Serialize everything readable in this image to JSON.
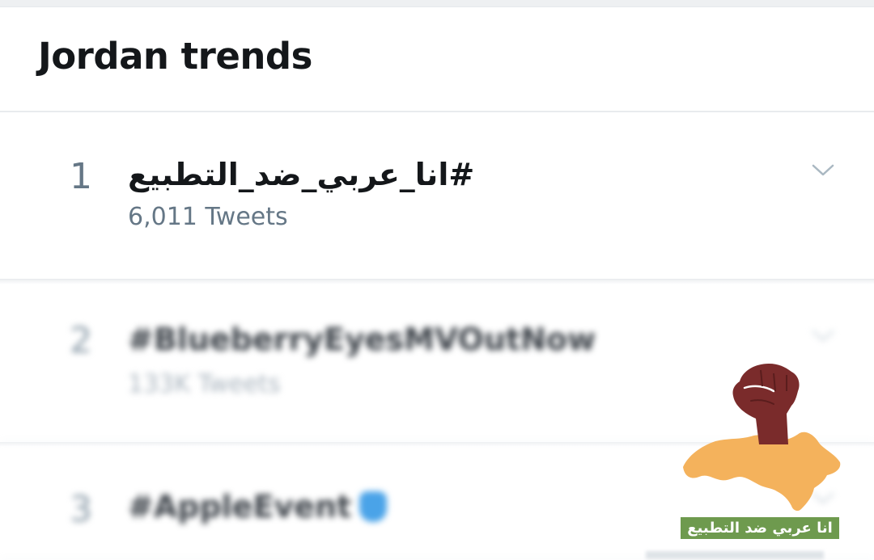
{
  "header": {
    "title": "Jordan trends"
  },
  "trends": [
    {
      "rank": "1",
      "name": "#انا_عربي_ضد_التطبيع",
      "meta": "6,011 Tweets"
    },
    {
      "rank": "2",
      "name": "#BlueberryEyesMVOutNow",
      "meta": "133K Tweets"
    },
    {
      "rank": "3",
      "name": "#AppleEvent"
    }
  ],
  "watermark": {
    "caption": "انا عربي ضد التطبيع",
    "fist_color": "#7a2b2b",
    "map_color": "#f4b25c",
    "caption_bg": "#6e9a4e"
  },
  "colors": {
    "text_primary": "#14171a",
    "text_secondary": "#657786",
    "divider": "#e8ebee"
  },
  "icons": {
    "trend_menu": "chevron-down-icon",
    "trend3_emoji": "apple-logo-icon"
  }
}
